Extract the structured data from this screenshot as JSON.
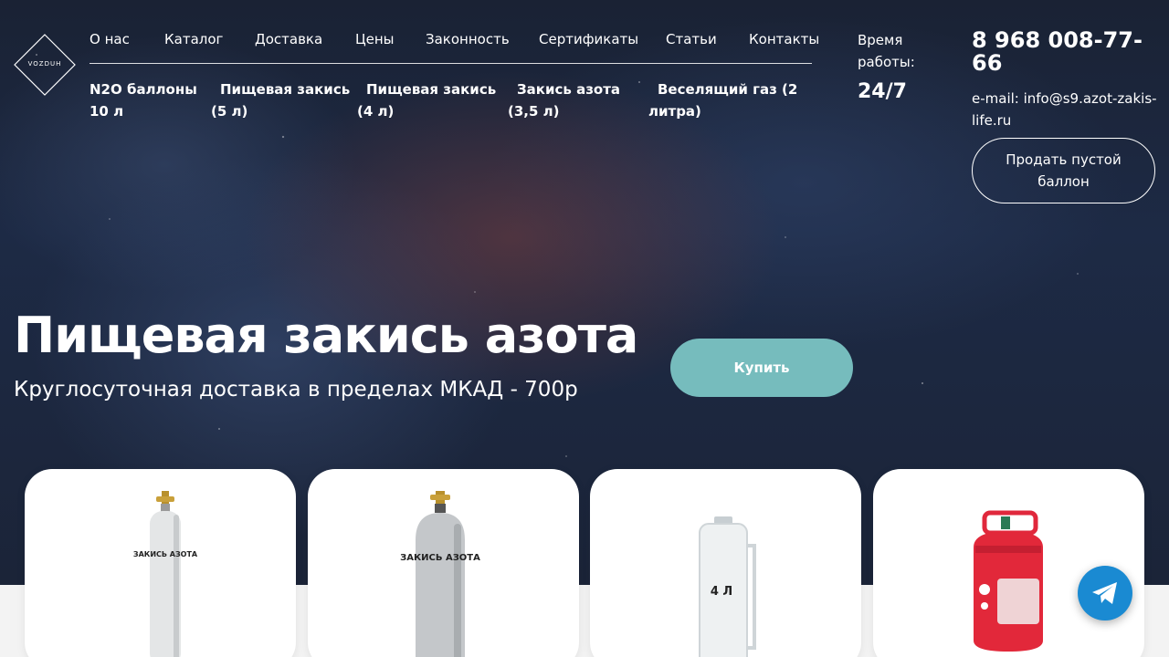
{
  "logo": {
    "text": "VOZDUH"
  },
  "nav": {
    "items": [
      "О нас",
      "Каталог",
      "Доставка",
      "Цены",
      "Законность",
      "Сертификаты",
      "Статьи",
      "Контакты"
    ]
  },
  "subnav": {
    "items": [
      "N2O баллоны 10 л",
      "Пищевая закись (5 л)",
      "Пищевая закись (4 л)",
      "Закись азота (3,5 л)",
      "Веселящий газ (2 литра)"
    ]
  },
  "hours": {
    "label": "Время работы:",
    "value": "24/7"
  },
  "contacts": {
    "phone": "8 968 008-77-66",
    "email": "e-mail: info@s9.azot-zakis-life.ru",
    "sell_button": "Продать пустой баллон"
  },
  "hero": {
    "title": "Пищевая закись азота",
    "subtitle": "Круглосуточная доставка в пределах МКАД - 700р",
    "buy_button": "Купить"
  },
  "products": [
    {
      "label": "ЗАКИСЬ АЗОТА",
      "icon": "gas-cylinder-slim"
    },
    {
      "label": "ЗАКИСЬ АЗОТА",
      "icon": "gas-cylinder-wide"
    },
    {
      "label": "4 Л",
      "icon": "gas-can-4l"
    },
    {
      "label": "",
      "icon": "red-balloon-gas-tank"
    }
  ],
  "colors": {
    "accent": "#76bcbd",
    "telegram": "#1a8ad2"
  }
}
